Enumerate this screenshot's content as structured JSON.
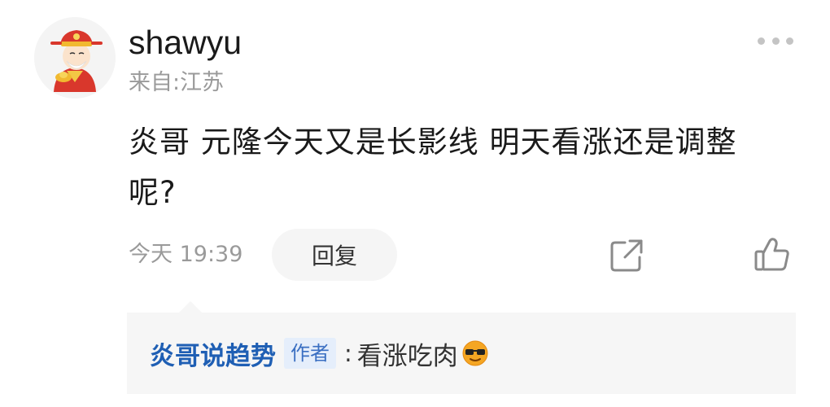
{
  "comment": {
    "username": "shawyu",
    "location": "来自:江苏",
    "text": "炎哥 元隆今天又是长影线 明天看涨还是调整呢?",
    "timestamp": "今天 19:39",
    "reply_label": "回复",
    "icons": {
      "avatar": "avatar-god-of-wealth",
      "more": "more-dots-icon",
      "share": "share-icon",
      "like": "thumbs-up-icon"
    }
  },
  "reply": {
    "author": "炎哥说趋势",
    "badge": "作者",
    "separator": ":",
    "text": "看涨吃肉",
    "emoji": "cool-sunglasses-emoji"
  },
  "colors": {
    "author_link": "#1f5fb4",
    "badge_bg": "#e5eefb",
    "muted_text": "#9a9a9a",
    "reply_bg": "#f6f6f6"
  }
}
